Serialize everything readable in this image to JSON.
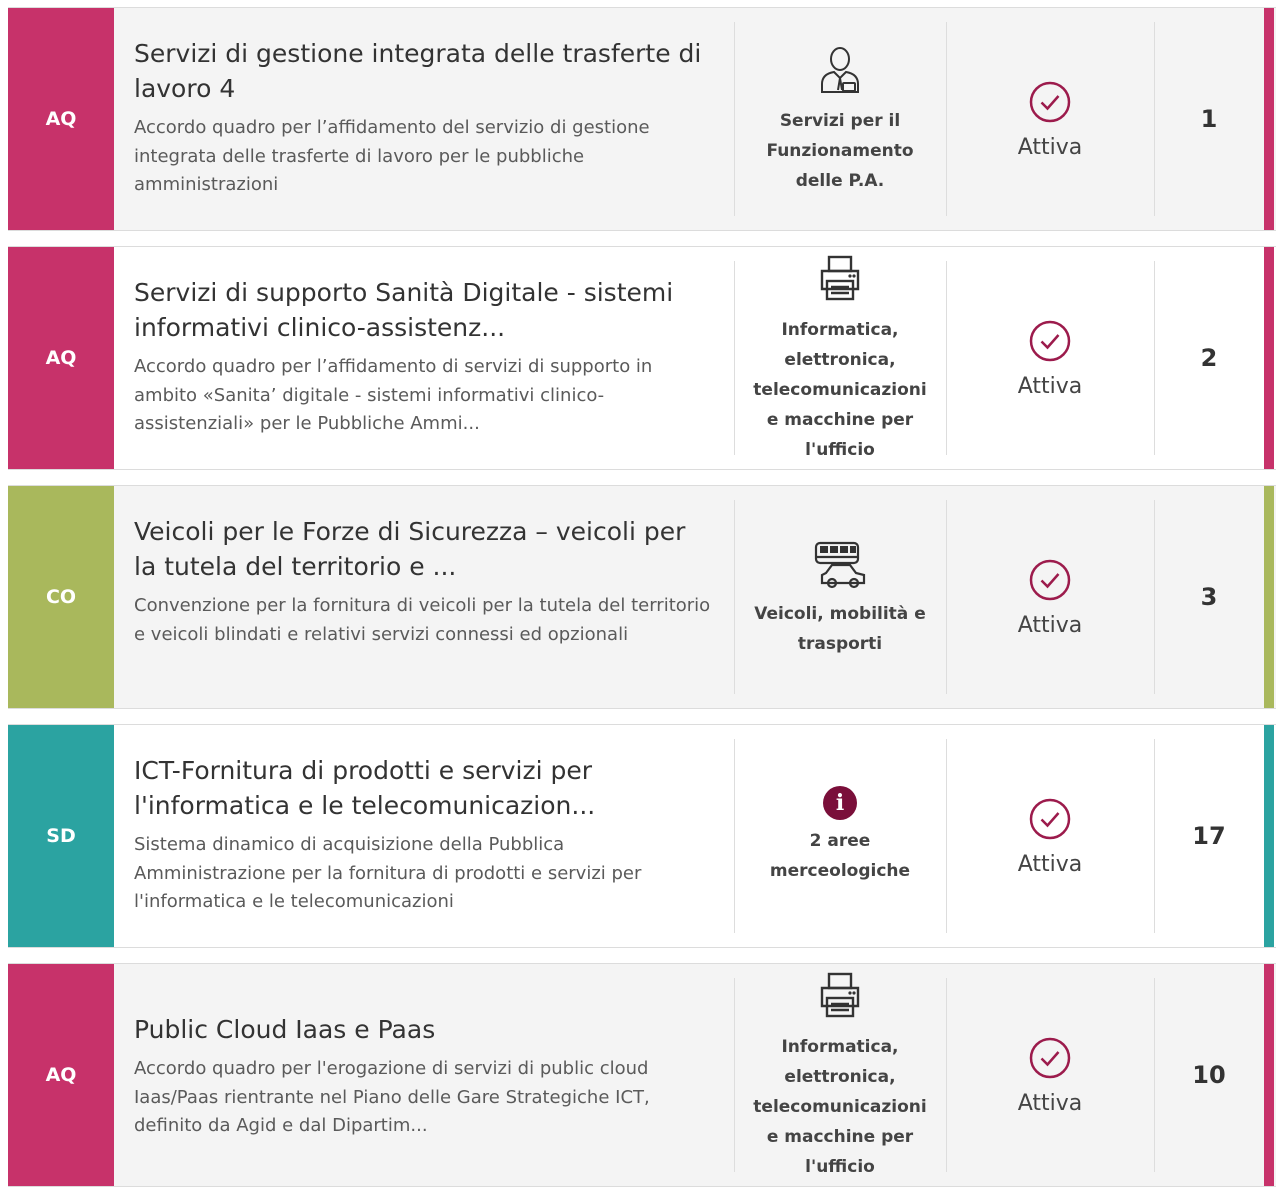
{
  "items": [
    {
      "type": "AQ",
      "type_color": "#c7326a",
      "title": "Servizi di gestione integrata delle trasferte di lavoro 4",
      "description": "Accordo quadro per l’affidamento del servizio di gestione integrata delle trasferte di lavoro per le pubbliche amministrazioni",
      "category_icon": "person-icon",
      "category": "Servizi per il Funzionamento delle P.A.",
      "status": "Attiva",
      "count": "1"
    },
    {
      "type": "AQ",
      "type_color": "#c7326a",
      "title": "Servizi di supporto Sanità Digitale - sistemi informativi clinico-assistenz...",
      "description": "Accordo quadro per l’affidamento di servizi di supporto in ambito «Sanita’ digitale - sistemi informativi clinico-assistenziali» per le Pubbliche Ammi...",
      "category_icon": "printer-icon",
      "category": "Informatica, elettronica, telecomunicazioni e macchine per l'ufficio",
      "status": "Attiva",
      "count": "2"
    },
    {
      "type": "CO",
      "type_color": "#a9b85c",
      "title": "Veicoli per le Forze di Sicurezza – veicoli per la tutela del territorio e ...",
      "description": "Convenzione per la fornitura di veicoli per la tutela del territorio e veicoli blindati e relativi servizi connessi ed opzionali",
      "category_icon": "vehicles-icon",
      "category": "Veicoli, mobilità e trasporti",
      "status": "Attiva",
      "count": "3"
    },
    {
      "type": "SD",
      "type_color": "#2ba3a1",
      "title": "ICT-Fornitura di prodotti e servizi per l'informatica e le telecomunicazion...",
      "description": "Sistema dinamico di acquisizione della Pubblica Amministrazione per la fornitura di prodotti e servizi per l'informatica e le telecomunicazioni",
      "category_icon": "info-icon",
      "category": "2 aree merceologiche",
      "status": "Attiva",
      "count": "17"
    },
    {
      "type": "AQ",
      "type_color": "#c7326a",
      "title": "Public Cloud Iaas e Paas",
      "description": "Accordo quadro per l'erogazione di servizi di public cloud Iaas/Paas rientrante nel Piano delle Gare Strategiche ICT, definito da Agid e dal Dipartim...",
      "category_icon": "printer-icon",
      "category": "Informatica, elettronica, telecomunicazioni e macchine per l'ufficio",
      "status": "Attiva",
      "count": "10"
    }
  ],
  "colors": {
    "status_icon": "#9c1b4c"
  }
}
